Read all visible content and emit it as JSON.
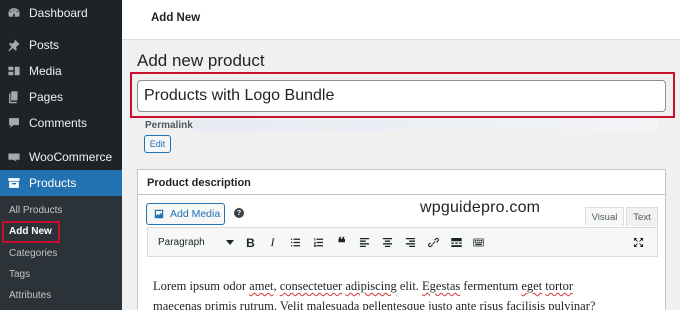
{
  "sidebar": {
    "items": [
      {
        "label": "Dashboard",
        "icon": "dashboard-icon"
      },
      {
        "label": "Posts",
        "icon": "pin-icon"
      },
      {
        "label": "Media",
        "icon": "media-icon"
      },
      {
        "label": "Pages",
        "icon": "pages-icon"
      },
      {
        "label": "Comments",
        "icon": "comment-icon"
      },
      {
        "label": "WooCommerce",
        "icon": "woocommerce-icon"
      },
      {
        "label": "Products",
        "icon": "products-icon"
      }
    ],
    "submenu": [
      "All Products",
      "Add New",
      "Categories",
      "Tags",
      "Attributes"
    ]
  },
  "header": {
    "title": "Add New"
  },
  "page": {
    "title": "Add new product"
  },
  "product": {
    "title_value": "Products with Logo Bundle"
  },
  "permalink": {
    "label": "Permalink:",
    "edit_label": "Edit"
  },
  "description": {
    "title": "Product description",
    "add_media": "Add Media",
    "help": "?",
    "tabs": [
      "Visual",
      "Text"
    ],
    "format": "Paragraph",
    "line1_parts": [
      "Lorem ipsum odor ",
      "amet",
      ", ",
      "consectetuer",
      " ",
      "adipiscing",
      " elit. ",
      "Egestas",
      " fermentum ",
      "eget",
      " ",
      "tortor"
    ],
    "line2_parts": [
      "maecenas",
      " ",
      "primis",
      " ",
      "rutrum",
      ". ",
      "Velit",
      " ",
      "malesuada",
      " ",
      "pellentesque",
      " justo ante ",
      "risus",
      " ",
      "facilisis",
      " ",
      "pulvinar",
      "?"
    ]
  },
  "watermark": "wpguidepro.com",
  "colors": {
    "sidebar_bg": "#1d2327",
    "accent": "#2271b1",
    "highlight": "#c8102e"
  }
}
